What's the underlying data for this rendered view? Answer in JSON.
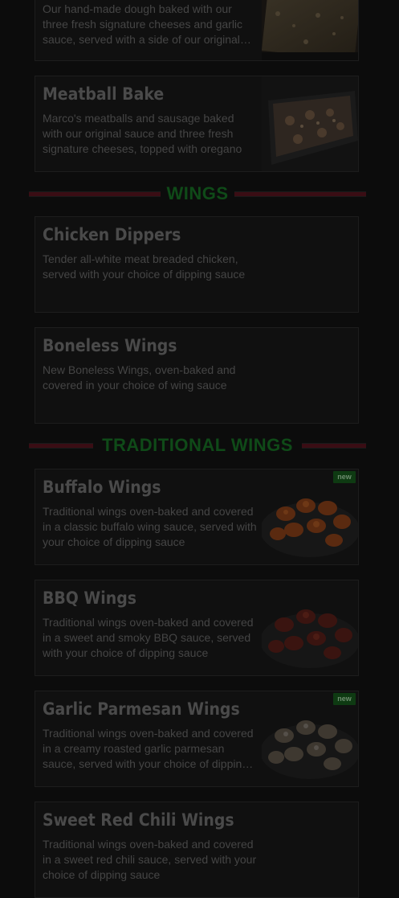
{
  "menu": {
    "items_top": [
      {
        "title": "",
        "description": "Our hand-made dough baked with our three fresh signature cheeses and garlic sauce, served with a side of our original sauce"
      },
      {
        "title": "Meatball Bake",
        "description": "Marco's meatballs and sausage baked with our original sauce and three fresh signature cheeses, topped with oregano"
      }
    ],
    "sections": [
      {
        "heading": "WINGS",
        "items": [
          {
            "title": "Chicken Dippers",
            "description": "Tender all-white meat breaded chicken, served with your choice of dipping sauce"
          },
          {
            "title": "Boneless Wings",
            "description": "New Boneless Wings, oven-baked and covered in your choice of wing sauce"
          }
        ]
      },
      {
        "heading": "TRADITIONAL WINGS",
        "items": [
          {
            "title": "Buffalo Wings",
            "description": "Traditional wings oven-baked and covered in a classic buffalo wing sauce, served with your choice of dipping sauce",
            "badge": "new"
          },
          {
            "title": "BBQ Wings",
            "description": "Traditional wings oven-baked and covered in a sweet and smoky BBQ sauce, served with your choice of dipping sauce"
          },
          {
            "title": "Garlic Parmesan Wings",
            "description": "Traditional wings oven-baked and covered in a creamy roasted garlic parmesan sauce, served with your choice of dipping sauce",
            "badge": "new"
          },
          {
            "title": "Sweet Red Chili Wings",
            "description": "Traditional wings oven-baked and covered in a sweet red chili sauce, served with your choice of dipping sauce"
          }
        ]
      }
    ]
  },
  "colors": {
    "background": "#0c0c0c",
    "title_text": "#4a4a4a",
    "section_heading": "#0f4a18",
    "section_rule": "#3a0d14",
    "badge_bg": "#0e3a12"
  }
}
